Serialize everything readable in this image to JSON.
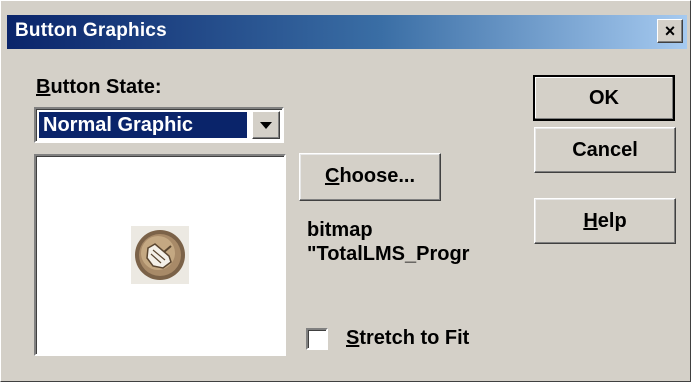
{
  "window": {
    "title": "Button Graphics",
    "close_symbol": "×"
  },
  "button_state": {
    "label_access": "B",
    "label_rest": "utton State:",
    "selected": "Normal Graphic"
  },
  "preview": {
    "icon": "hand-pointer-graphic"
  },
  "choose_button": {
    "access": "C",
    "rest": "hoose..."
  },
  "file_info": {
    "line1": "bitmap",
    "line2": "\"TotalLMS_Progr"
  },
  "stretch": {
    "access": "S",
    "rest": "tretch to Fit",
    "checked": false
  },
  "buttons": {
    "ok": "OK",
    "cancel": "Cancel",
    "help_access": "H",
    "help_rest": "elp"
  },
  "colors": {
    "title_gradient_start": "#0a246a",
    "title_gradient_end": "#a6caf0",
    "face": "#d4d0c8",
    "selection": "#0a246a"
  }
}
